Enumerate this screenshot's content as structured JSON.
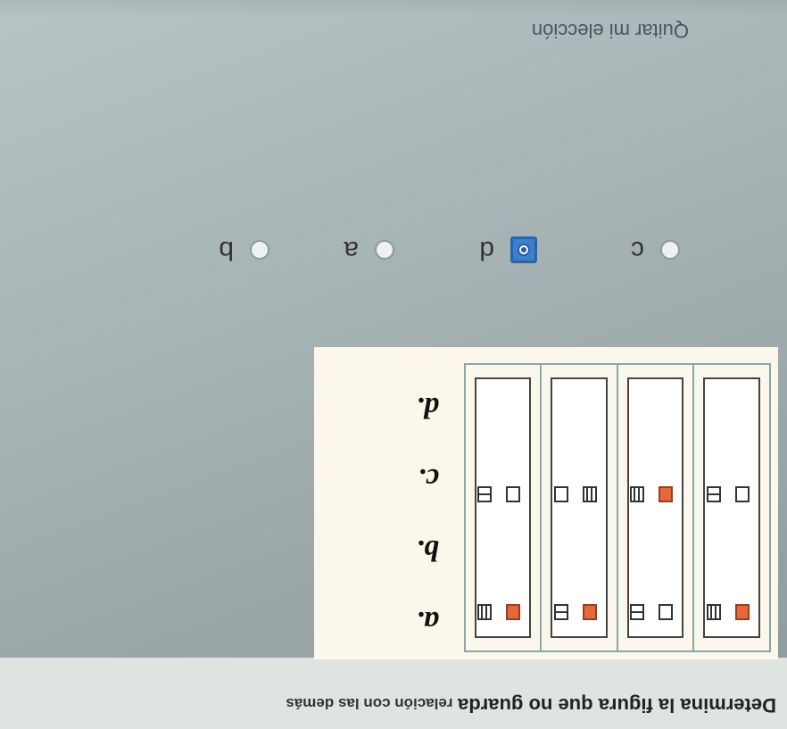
{
  "question": {
    "main": "Determina la figura que no guarda",
    "rest": "relación con las demás"
  },
  "figure_labels": [
    "a.",
    "b.",
    "c.",
    "d."
  ],
  "options": [
    {
      "label": "c",
      "checked": false
    },
    {
      "label": "d",
      "checked": true
    },
    {
      "label": "a",
      "checked": false
    },
    {
      "label": "b",
      "checked": false
    }
  ],
  "clear_choice": "Quitar mi elección",
  "colors": {
    "accent_orange": "#e5683a",
    "radio_checked": "#3a7fd0",
    "panel_bg": "#fbf7ea",
    "table_border": "#8aa6a8"
  }
}
